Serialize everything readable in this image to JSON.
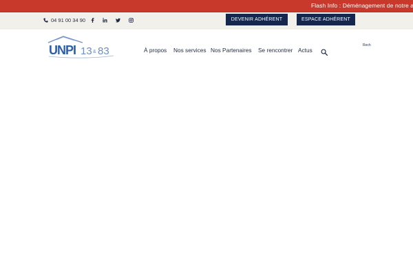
{
  "flash": {
    "text": "Flash Info : Déménagement de notre ant"
  },
  "topbar": {
    "phone": "04 91 00 34 90",
    "social_icons": [
      "facebook-icon",
      "linkedin-icon",
      "twitter-icon",
      "instagram-icon"
    ],
    "buttons": {
      "devenir": "DEVENIR ADHÉRENT",
      "espace": "ESPACE ADHÉRENT"
    }
  },
  "logo": {
    "brand": "UNPI",
    "numbers": "13",
    "ampersand": "&",
    "numbers2": "83"
  },
  "nav": {
    "items": [
      "À propos",
      "Nos services",
      "Nos Partenaires",
      "Se rencontrer",
      "Actus"
    ]
  },
  "search": {
    "placeholder": "Rech"
  },
  "colors": {
    "flash_red": "#c8392b",
    "topbar_bg": "#f2f0ea",
    "navy": "#16274d",
    "text": "#1e2a44",
    "logo_blue": "#2b5fa8",
    "logo_light": "#6b8fc4"
  }
}
